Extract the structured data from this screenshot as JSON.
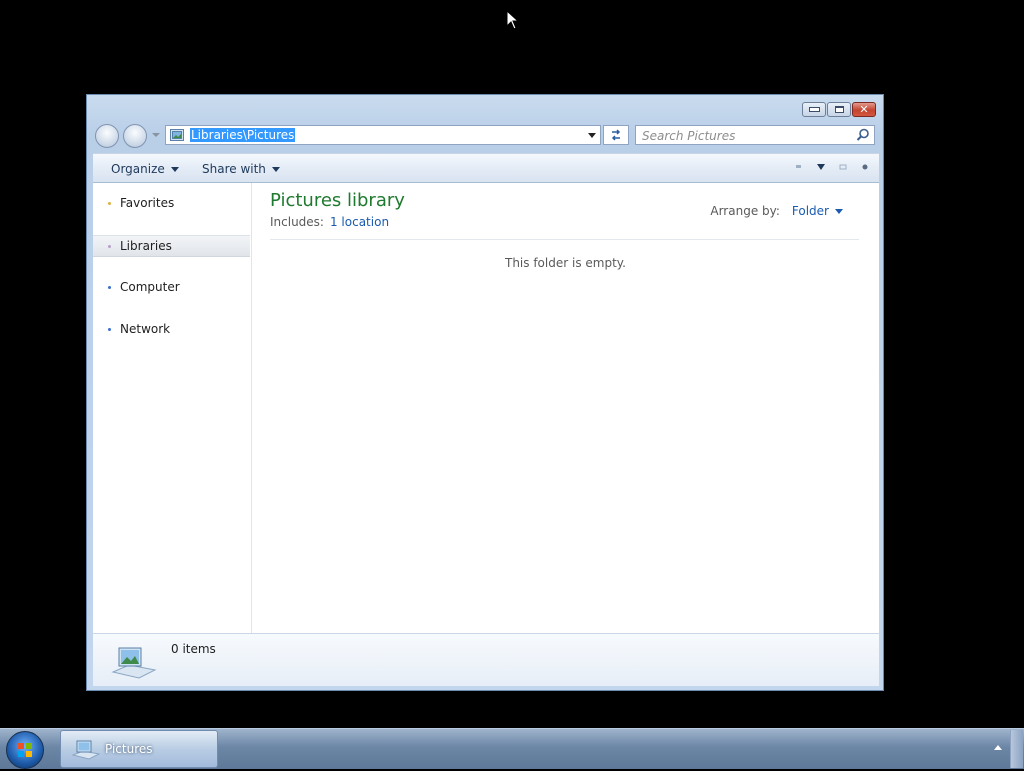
{
  "window": {
    "address": "Libraries\\Pictures",
    "search_placeholder": "Search Pictures"
  },
  "toolbar": {
    "organize_label": "Organize",
    "share_label": "Share with"
  },
  "nav": {
    "items": [
      {
        "label": "Favorites",
        "bullet_color": "#e0b040"
      },
      {
        "label": "Libraries",
        "bullet_color": "#b8a0c8"
      },
      {
        "label": "Computer",
        "bullet_color": "#3a6fd0"
      },
      {
        "label": "Network",
        "bullet_color": "#3a6fd0"
      }
    ],
    "selected": "Libraries"
  },
  "main": {
    "title": "Pictures library",
    "includes_label": "Includes:",
    "includes_link": "1 location",
    "arrange_label": "Arrange by:",
    "arrange_value": "Folder",
    "empty_text": "This folder is empty."
  },
  "details": {
    "items_count": "0 items"
  },
  "taskbar": {
    "item_label": "Pictures"
  },
  "colors": {
    "library_title": "#1e7a2e",
    "link": "#1a5bb0",
    "selection": "#3399ff"
  }
}
